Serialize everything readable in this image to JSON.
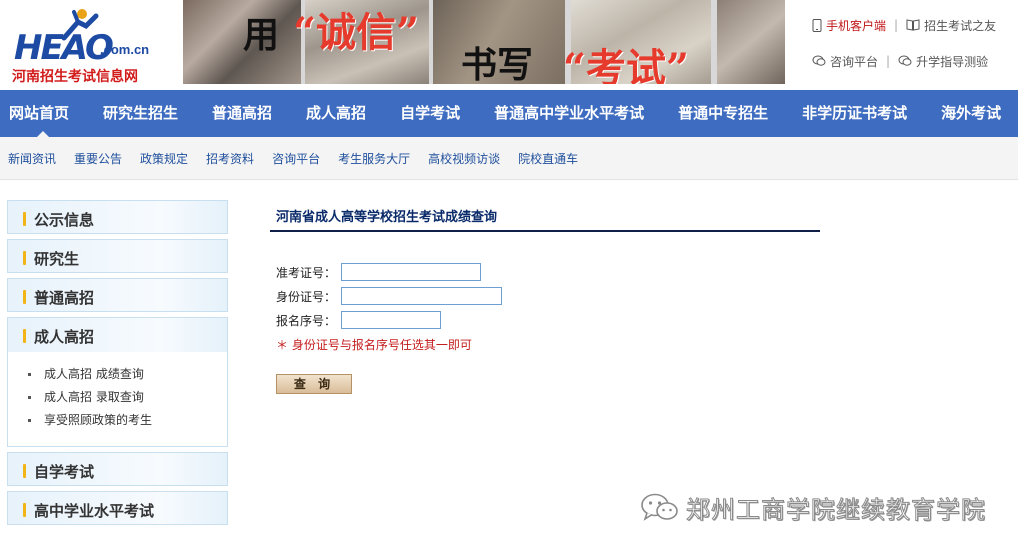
{
  "header": {
    "logo": {
      "mark": "HEAO",
      "domain": ".com.cn",
      "name": "河南招生考试信息网"
    },
    "banner": {
      "yong": "用",
      "chengxin": "“诚信”",
      "shuxie": "书写",
      "kaoshi": "“考试”"
    },
    "top_links": [
      {
        "label": "手机客户端",
        "icon": "mobile-icon",
        "color": "#c01818"
      },
      {
        "label": "招生考试之友",
        "icon": "book-icon"
      },
      {
        "label": "咨询平台",
        "icon": "chat-icon"
      },
      {
        "label": "升学指导测验",
        "icon": "chat-icon"
      }
    ]
  },
  "nav": {
    "items": [
      "网站首页",
      "研究生招生",
      "普通高招",
      "成人高招",
      "自学考试",
      "普通高中学业水平考试",
      "普通中专招生",
      "非学历证书考试",
      "海外考试"
    ],
    "active_index": 0
  },
  "subnav": {
    "items": [
      "新闻资讯",
      "重要公告",
      "政策规定",
      "招考资料",
      "咨询平台",
      "考生服务大厅",
      "高校视频访谈",
      "院校直通车"
    ]
  },
  "sidebar": {
    "categories": [
      "公示信息",
      "研究生",
      "普通高招",
      "成人高招",
      "自学考试",
      "高中学业水平考试"
    ],
    "expanded_index": 3,
    "expanded_items": [
      "成人高招 成绩查询",
      "成人高招 录取查询",
      "享受照顾政策的考生"
    ]
  },
  "form": {
    "title": "河南省成人高等学校招生考试成绩查询",
    "fields": [
      {
        "label": "准考证号：",
        "value": ""
      },
      {
        "label": "身份证号：",
        "value": ""
      },
      {
        "label": "报名序号：",
        "value": ""
      }
    ],
    "note": "＊ 身份证号与报名序号任选其一即可",
    "submit": "查 询"
  },
  "watermark": {
    "text": "郑州工商学院继续教育学院",
    "icon": "wechat-icon"
  },
  "colors": {
    "nav_bg": "#3e6cc0",
    "accent_red": "#c01818",
    "sidebar_bar": "#f2b417",
    "link_blue": "#1f4f9c"
  }
}
